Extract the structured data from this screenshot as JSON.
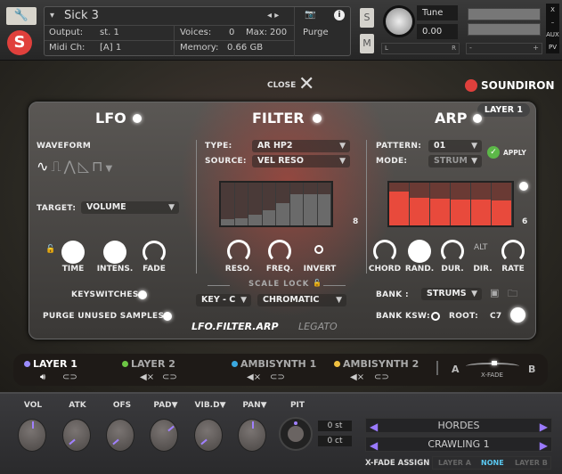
{
  "header": {
    "instrument_name": "Sick 3",
    "output_label": "Output:",
    "output_value": "st. 1",
    "midi_label": "Midi Ch:",
    "midi_value": "[A] 1",
    "voices_label": "Voices:",
    "voices_value": "0",
    "max_label": "Max:",
    "max_value": "200",
    "memory_label": "Memory:",
    "memory_value": "0.66 GB",
    "purge_label": "Purge",
    "solo": "S",
    "mute": "M",
    "tune_label": "Tune",
    "tune_value": "0.00",
    "pan_l": "L",
    "pan_r": "R",
    "close_x": "X",
    "minimize": "–",
    "aux": "AUX",
    "pv": "PV",
    "vol_minus": "-",
    "vol_plus": "+"
  },
  "top": {
    "close_label": "CLOSE",
    "brand": "SOUNDIRON",
    "layer_badge": "LAYER 1"
  },
  "lfo": {
    "title": "LFO",
    "waveform_label": "WAVEFORM",
    "target_label": "TARGET:",
    "target_value": "VOLUME",
    "knobs": [
      "TIME",
      "INTENS.",
      "FADE"
    ],
    "keyswitches": "KEYSWITCHES",
    "purge": "PURGE UNUSED SAMPLES"
  },
  "filter": {
    "title": "FILTER",
    "type_label": "TYPE:",
    "type_value": "AR HP2",
    "source_label": "SOURCE:",
    "source_value": "VEL RESO",
    "steps": "8",
    "step_values": [
      0.15,
      0.17,
      0.26,
      0.35,
      0.53,
      0.73,
      0.73,
      0.73
    ],
    "knobs": [
      "RESO.",
      "FREQ.",
      "INVERT"
    ],
    "scale_lock": "SCALE LOCK",
    "key_value": "KEY - C",
    "scale_value": "CHROMATIC"
  },
  "arp": {
    "title": "ARP",
    "pattern_label": "PATTERN:",
    "pattern_value": "01",
    "apply": "APPLY",
    "mode_label": "MODE:",
    "mode_value": "STRUM",
    "steps": "6",
    "step_values": [
      0.8,
      0.64,
      0.62,
      0.6,
      0.6,
      0.58
    ],
    "knobs": [
      "CHORD",
      "RAND.",
      "DUR.",
      "DIR.",
      "RATE"
    ],
    "dir_value": "ALT",
    "bank_label": "BANK :",
    "bank_value": "STRUMS",
    "bank_ksw_label": "BANK KSW:",
    "root_label": "ROOT:",
    "root_value": "C7",
    "step_color": "#e84a3c"
  },
  "tabs": {
    "active": "LFO.FILTER.ARP",
    "other": "LEGATO"
  },
  "layers": [
    {
      "name": "LAYER 1",
      "color": "#9b8cff"
    },
    {
      "name": "LAYER 2",
      "color": "#6cc644"
    },
    {
      "name": "AMBISYNTH 1",
      "color": "#3aa8e0"
    },
    {
      "name": "AMBISYNTH 2",
      "color": "#f0c040"
    }
  ],
  "xfade": {
    "a": "A",
    "b": "B",
    "label": "X-FADE"
  },
  "bottom": {
    "knobs": [
      "VOL",
      "ATK",
      "OFS",
      "PAD▼",
      "VIB.D▼",
      "PAN▼",
      "PIT"
    ],
    "semitones": "0 st",
    "cents": "0 ct",
    "preset1": "HORDES",
    "preset2": "CRAWLING 1",
    "xfade_assign": "X-FADE ASSIGN",
    "assign_options": [
      "LAYER A",
      "NONE",
      "LAYER B"
    ]
  }
}
